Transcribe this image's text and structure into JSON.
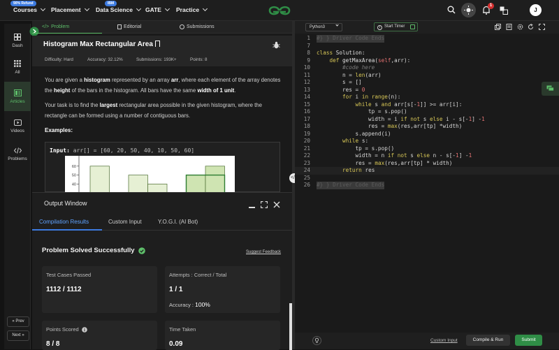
{
  "nav": {
    "items": [
      {
        "label": "Courses",
        "badge": "90% Refund"
      },
      {
        "label": "Placement"
      },
      {
        "label": "Data Science",
        "badge": "IBM"
      },
      {
        "label": "GATE"
      },
      {
        "label": "Practice"
      }
    ],
    "notification_count": "1",
    "avatar_initial": "J",
    "logo": "geeksforgeeks-logo",
    "colors": {
      "brand": "#2f8d46",
      "accent": "#5ebf6a",
      "badge_blue": "#3d7be0",
      "badge_red": "#d32f2f"
    }
  },
  "sidebar": {
    "items": [
      {
        "label": "Dash",
        "icon": "dashboard-icon"
      },
      {
        "label": "All",
        "icon": "grid-icon"
      },
      {
        "label": "Articles",
        "icon": "articles-icon",
        "active": true
      },
      {
        "label": "Videos",
        "icon": "video-icon"
      },
      {
        "label": "Problems",
        "icon": "code-icon"
      }
    ],
    "prev_label": "« Prev",
    "next_label": "Next »"
  },
  "problem": {
    "tabs": [
      "Problem",
      "Editorial",
      "Submissions"
    ],
    "title": "Histogram Max Rectangular Area",
    "difficulty": "Difficulty: Hard",
    "accuracy": "Accuracy: 32.12%",
    "submissions": "Submissions: 193K+",
    "points": "Points: 8",
    "desc1": {
      "a": "You are given a ",
      "b": "histogram",
      "c": " represented by an array ",
      "d": "arr",
      "e": ", where each element of the array denotes the ",
      "f": "height",
      "g": " of the bars in the histogram. All bars have the same ",
      "h": "width of 1 unit",
      "i": "."
    },
    "desc2": {
      "a": "Your task is to find the ",
      "b": "largest",
      "c": " rectangular area possible in the given histogram, where the rectangle can be formed using a number of contiguous bars."
    },
    "examples_label": "Examples:",
    "example_input_label": "Input:",
    "example_input_value": "arr[] = [60, 20, 50, 40, 10, 50, 60]"
  },
  "example_chart": {
    "type": "bar",
    "values": [
      60,
      20,
      50,
      40,
      10,
      50,
      60
    ],
    "ticks": [
      "60",
      "50",
      "40"
    ]
  },
  "output": {
    "title": "Output Window",
    "tabs": [
      "Compilation Results",
      "Custom Input",
      "Y.O.G.I. (AI Bot)"
    ],
    "status": "Problem Solved Successfully",
    "feedback": "Suggest Feedback",
    "test_cases_label": "Test Cases Passed",
    "test_cases_value": "1112 / 1112",
    "attempts_label": "Attempts : Correct / Total",
    "attempts_value": "1 / 1",
    "accuracy_label": "Accuracy :",
    "accuracy_value": "100%",
    "points_label": "Points Scored",
    "points_value": "8 / 8",
    "time_label": "Time Taken",
    "time_value": "0.09"
  },
  "editor": {
    "language": "Python3",
    "timer_label": "Start Timer",
    "custom_input": "Custom Input",
    "compile_label": "Compile & Run",
    "submit_label": "Submit"
  }
}
